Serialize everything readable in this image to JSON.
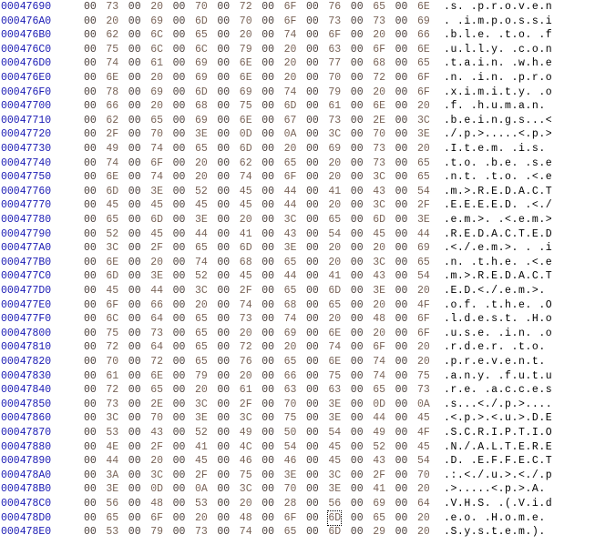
{
  "hex_editor": {
    "cursor": {
      "row": 36,
      "byte": 11
    },
    "colors": {
      "offset": "#1a1ab4",
      "hex": "#7a6458",
      "ascii": "#000000",
      "background": "#ffffff"
    },
    "rows": [
      {
        "offset": "00047690",
        "hex": [
          "00",
          "73",
          "00",
          "20",
          "00",
          "70",
          "00",
          "72",
          "00",
          "6F",
          "00",
          "76",
          "00",
          "65",
          "00",
          "6E"
        ],
        "ascii": ".s. .p.r.o.v.e.n"
      },
      {
        "offset": "000476A0",
        "hex": [
          "00",
          "20",
          "00",
          "69",
          "00",
          "6D",
          "00",
          "70",
          "00",
          "6F",
          "00",
          "73",
          "00",
          "73",
          "00",
          "69"
        ],
        "ascii": ". .i.m.p.o.s.s.i"
      },
      {
        "offset": "000476B0",
        "hex": [
          "00",
          "62",
          "00",
          "6C",
          "00",
          "65",
          "00",
          "20",
          "00",
          "74",
          "00",
          "6F",
          "00",
          "20",
          "00",
          "66"
        ],
        "ascii": ".b.l.e. .t.o. .f"
      },
      {
        "offset": "000476C0",
        "hex": [
          "00",
          "75",
          "00",
          "6C",
          "00",
          "6C",
          "00",
          "79",
          "00",
          "20",
          "00",
          "63",
          "00",
          "6F",
          "00",
          "6E"
        ],
        "ascii": ".u.l.l.y. .c.o.n"
      },
      {
        "offset": "000476D0",
        "hex": [
          "00",
          "74",
          "00",
          "61",
          "00",
          "69",
          "00",
          "6E",
          "00",
          "20",
          "00",
          "77",
          "00",
          "68",
          "00",
          "65"
        ],
        "ascii": ".t.a.i.n. .w.h.e"
      },
      {
        "offset": "000476E0",
        "hex": [
          "00",
          "6E",
          "00",
          "20",
          "00",
          "69",
          "00",
          "6E",
          "00",
          "20",
          "00",
          "70",
          "00",
          "72",
          "00",
          "6F"
        ],
        "ascii": ".n. .i.n. .p.r.o"
      },
      {
        "offset": "000476F0",
        "hex": [
          "00",
          "78",
          "00",
          "69",
          "00",
          "6D",
          "00",
          "69",
          "00",
          "74",
          "00",
          "79",
          "00",
          "20",
          "00",
          "6F"
        ],
        "ascii": ".x.i.m.i.t.y. .o"
      },
      {
        "offset": "00047700",
        "hex": [
          "00",
          "66",
          "00",
          "20",
          "00",
          "68",
          "00",
          "75",
          "00",
          "6D",
          "00",
          "61",
          "00",
          "6E",
          "00",
          "20"
        ],
        "ascii": ".f. .h.u.m.a.n. "
      },
      {
        "offset": "00047710",
        "hex": [
          "00",
          "62",
          "00",
          "65",
          "00",
          "69",
          "00",
          "6E",
          "00",
          "67",
          "00",
          "73",
          "00",
          "2E",
          "00",
          "3C"
        ],
        "ascii": ".b.e.i.n.g.s...<"
      },
      {
        "offset": "00047720",
        "hex": [
          "00",
          "2F",
          "00",
          "70",
          "00",
          "3E",
          "00",
          "0D",
          "00",
          "0A",
          "00",
          "3C",
          "00",
          "70",
          "00",
          "3E"
        ],
        "ascii": "./.p.>.....<.p.>"
      },
      {
        "offset": "00047730",
        "hex": [
          "00",
          "49",
          "00",
          "74",
          "00",
          "65",
          "00",
          "6D",
          "00",
          "20",
          "00",
          "69",
          "00",
          "73",
          "00",
          "20"
        ],
        "ascii": ".I.t.e.m. .i.s. "
      },
      {
        "offset": "00047740",
        "hex": [
          "00",
          "74",
          "00",
          "6F",
          "00",
          "20",
          "00",
          "62",
          "00",
          "65",
          "00",
          "20",
          "00",
          "73",
          "00",
          "65"
        ],
        "ascii": ".t.o. .b.e. .s.e"
      },
      {
        "offset": "00047750",
        "hex": [
          "00",
          "6E",
          "00",
          "74",
          "00",
          "20",
          "00",
          "74",
          "00",
          "6F",
          "00",
          "20",
          "00",
          "3C",
          "00",
          "65"
        ],
        "ascii": ".n.t. .t.o. .<.e"
      },
      {
        "offset": "00047760",
        "hex": [
          "00",
          "6D",
          "00",
          "3E",
          "00",
          "52",
          "00",
          "45",
          "00",
          "44",
          "00",
          "41",
          "00",
          "43",
          "00",
          "54"
        ],
        "ascii": ".m.>.R.E.D.A.C.T"
      },
      {
        "offset": "00047770",
        "hex": [
          "00",
          "45",
          "00",
          "45",
          "00",
          "45",
          "00",
          "45",
          "00",
          "44",
          "00",
          "20",
          "00",
          "3C",
          "00",
          "2F"
        ],
        "ascii": ".E.E.E.E.D. .<./"
      },
      {
        "offset": "00047780",
        "hex": [
          "00",
          "65",
          "00",
          "6D",
          "00",
          "3E",
          "00",
          "20",
          "00",
          "3C",
          "00",
          "65",
          "00",
          "6D",
          "00",
          "3E"
        ],
        "ascii": ".e.m.>. .<.e.m.>"
      },
      {
        "offset": "00047790",
        "hex": [
          "00",
          "52",
          "00",
          "45",
          "00",
          "44",
          "00",
          "41",
          "00",
          "43",
          "00",
          "54",
          "00",
          "45",
          "00",
          "44"
        ],
        "ascii": ".R.E.D.A.C.T.E.D"
      },
      {
        "offset": "000477A0",
        "hex": [
          "00",
          "3C",
          "00",
          "2F",
          "00",
          "65",
          "00",
          "6D",
          "00",
          "3E",
          "00",
          "20",
          "00",
          "20",
          "00",
          "69"
        ],
        "ascii": ".<./.e.m.>. . .i"
      },
      {
        "offset": "000477B0",
        "hex": [
          "00",
          "6E",
          "00",
          "20",
          "00",
          "74",
          "00",
          "68",
          "00",
          "65",
          "00",
          "20",
          "00",
          "3C",
          "00",
          "65"
        ],
        "ascii": ".n. .t.h.e. .<.e"
      },
      {
        "offset": "000477C0",
        "hex": [
          "00",
          "6D",
          "00",
          "3E",
          "00",
          "52",
          "00",
          "45",
          "00",
          "44",
          "00",
          "41",
          "00",
          "43",
          "00",
          "54"
        ],
        "ascii": ".m.>.R.E.D.A.C.T"
      },
      {
        "offset": "000477D0",
        "hex": [
          "00",
          "45",
          "00",
          "44",
          "00",
          "3C",
          "00",
          "2F",
          "00",
          "65",
          "00",
          "6D",
          "00",
          "3E",
          "00",
          "20"
        ],
        "ascii": ".E.D.<./.e.m.>. "
      },
      {
        "offset": "000477E0",
        "hex": [
          "00",
          "6F",
          "00",
          "66",
          "00",
          "20",
          "00",
          "74",
          "00",
          "68",
          "00",
          "65",
          "00",
          "20",
          "00",
          "4F"
        ],
        "ascii": ".o.f. .t.h.e. .O"
      },
      {
        "offset": "000477F0",
        "hex": [
          "00",
          "6C",
          "00",
          "64",
          "00",
          "65",
          "00",
          "73",
          "00",
          "74",
          "00",
          "20",
          "00",
          "48",
          "00",
          "6F"
        ],
        "ascii": ".l.d.e.s.t. .H.o"
      },
      {
        "offset": "00047800",
        "hex": [
          "00",
          "75",
          "00",
          "73",
          "00",
          "65",
          "00",
          "20",
          "00",
          "69",
          "00",
          "6E",
          "00",
          "20",
          "00",
          "6F"
        ],
        "ascii": ".u.s.e. .i.n. .o"
      },
      {
        "offset": "00047810",
        "hex": [
          "00",
          "72",
          "00",
          "64",
          "00",
          "65",
          "00",
          "72",
          "00",
          "20",
          "00",
          "74",
          "00",
          "6F",
          "00",
          "20"
        ],
        "ascii": ".r.d.e.r. .t.o. "
      },
      {
        "offset": "00047820",
        "hex": [
          "00",
          "70",
          "00",
          "72",
          "00",
          "65",
          "00",
          "76",
          "00",
          "65",
          "00",
          "6E",
          "00",
          "74",
          "00",
          "20"
        ],
        "ascii": ".p.r.e.v.e.n.t. "
      },
      {
        "offset": "00047830",
        "hex": [
          "00",
          "61",
          "00",
          "6E",
          "00",
          "79",
          "00",
          "20",
          "00",
          "66",
          "00",
          "75",
          "00",
          "74",
          "00",
          "75"
        ],
        "ascii": ".a.n.y. .f.u.t.u"
      },
      {
        "offset": "00047840",
        "hex": [
          "00",
          "72",
          "00",
          "65",
          "00",
          "20",
          "00",
          "61",
          "00",
          "63",
          "00",
          "63",
          "00",
          "65",
          "00",
          "73"
        ],
        "ascii": ".r.e. .a.c.c.e.s"
      },
      {
        "offset": "00047850",
        "hex": [
          "00",
          "73",
          "00",
          "2E",
          "00",
          "3C",
          "00",
          "2F",
          "00",
          "70",
          "00",
          "3E",
          "00",
          "0D",
          "00",
          "0A"
        ],
        "ascii": ".s...<./.p.>...."
      },
      {
        "offset": "00047860",
        "hex": [
          "00",
          "3C",
          "00",
          "70",
          "00",
          "3E",
          "00",
          "3C",
          "00",
          "75",
          "00",
          "3E",
          "00",
          "44",
          "00",
          "45"
        ],
        "ascii": ".<.p.>.<.u.>.D.E"
      },
      {
        "offset": "00047870",
        "hex": [
          "00",
          "53",
          "00",
          "43",
          "00",
          "52",
          "00",
          "49",
          "00",
          "50",
          "00",
          "54",
          "00",
          "49",
          "00",
          "4F"
        ],
        "ascii": ".S.C.R.I.P.T.I.O"
      },
      {
        "offset": "00047880",
        "hex": [
          "00",
          "4E",
          "00",
          "2F",
          "00",
          "41",
          "00",
          "4C",
          "00",
          "54",
          "00",
          "45",
          "00",
          "52",
          "00",
          "45"
        ],
        "ascii": ".N./.A.L.T.E.R.E"
      },
      {
        "offset": "00047890",
        "hex": [
          "00",
          "44",
          "00",
          "20",
          "00",
          "45",
          "00",
          "46",
          "00",
          "46",
          "00",
          "45",
          "00",
          "43",
          "00",
          "54"
        ],
        "ascii": ".D. .E.F.F.E.C.T"
      },
      {
        "offset": "000478A0",
        "hex": [
          "00",
          "3A",
          "00",
          "3C",
          "00",
          "2F",
          "00",
          "75",
          "00",
          "3E",
          "00",
          "3C",
          "00",
          "2F",
          "00",
          "70"
        ],
        "ascii": ".:.<./.u.>.<./.p"
      },
      {
        "offset": "000478B0",
        "hex": [
          "00",
          "3E",
          "00",
          "0D",
          "00",
          "0A",
          "00",
          "3C",
          "00",
          "70",
          "00",
          "3E",
          "00",
          "41",
          "00",
          "20"
        ],
        "ascii": ".>.....<.p.>.A. "
      },
      {
        "offset": "000478C0",
        "hex": [
          "00",
          "56",
          "00",
          "48",
          "00",
          "53",
          "00",
          "20",
          "00",
          "28",
          "00",
          "56",
          "00",
          "69",
          "00",
          "64"
        ],
        "ascii": ".V.H.S. .(.V.i.d"
      },
      {
        "offset": "000478D0",
        "hex": [
          "00",
          "65",
          "00",
          "6F",
          "00",
          "20",
          "00",
          "48",
          "00",
          "6F",
          "00",
          "6D",
          "00",
          "65",
          "00",
          "20"
        ],
        "ascii": ".e.o. .H.o.m.e. "
      },
      {
        "offset": "000478E0",
        "hex": [
          "00",
          "53",
          "00",
          "79",
          "00",
          "73",
          "00",
          "74",
          "00",
          "65",
          "00",
          "6D",
          "00",
          "29",
          "00",
          "20"
        ],
        "ascii": ".S.y.s.t.e.m.). "
      }
    ]
  }
}
